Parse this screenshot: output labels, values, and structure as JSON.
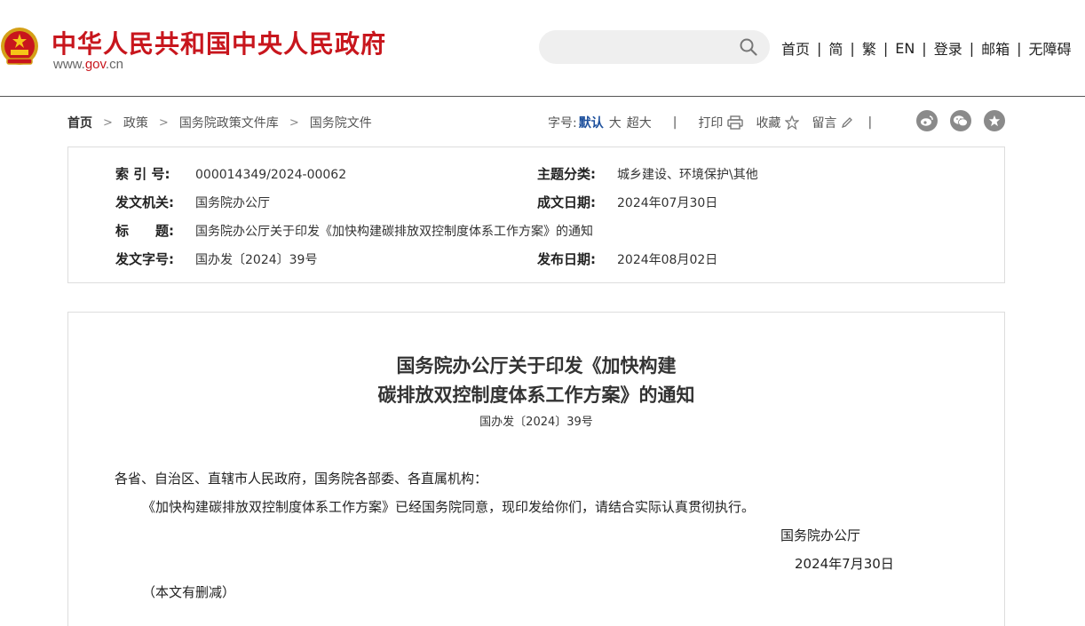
{
  "header": {
    "site_title": "中华人民共和国中央人民政府",
    "site_url_prefix": "www.",
    "site_url_gov": "gov",
    "site_url_suffix": ".cn",
    "search": {
      "placeholder": ""
    },
    "topnav": [
      "首页",
      "简",
      "繁",
      "EN",
      "登录",
      "邮箱",
      "无障碍"
    ]
  },
  "breadcrumb": [
    "首页",
    "政策",
    "国务院政策文件库",
    "国务院文件"
  ],
  "tools": {
    "font_size_label": "字号:",
    "font_default": "默认",
    "font_large": "大",
    "font_xlarge": "超大",
    "print": "打印",
    "favorite": "收藏",
    "comment": "留言",
    "share_icons": [
      "weibo-icon",
      "wechat-icon",
      "star-share-icon"
    ]
  },
  "info": {
    "index_no_label": "索 引 号:",
    "index_no": "000014349/2024-00062",
    "topic_label": "主题分类:",
    "topic": "城乡建设、环境保护\\其他",
    "issuer_label": "发文机关:",
    "issuer": "国务院办公厅",
    "written_date_label": "成文日期:",
    "written_date": "2024年07月30日",
    "title_label": "标　　题:",
    "title": "国务院办公厅关于印发《加快构建碳排放双控制度体系工作方案》的通知",
    "doc_no_label": "发文字号:",
    "doc_no": "国办发〔2024〕39号",
    "publish_date_label": "发布日期:",
    "publish_date": "2024年08月02日"
  },
  "article": {
    "title_line1": "国务院办公厅关于印发《加快构建",
    "title_line2": "碳排放双控制度体系工作方案》的通知",
    "doc_no": "国办发〔2024〕39号",
    "addressee": "各省、自治区、直辖市人民政府，国务院各部委、各直属机构：",
    "body": "《加快构建碳排放双控制度体系工作方案》已经国务院同意，现印发给你们，请结合实际认真贯彻执行。",
    "signer": "国务院办公厅",
    "date": "2024年7月30日",
    "note": "（本文有删减）"
  },
  "colors": {
    "brand_red": "#c8161d",
    "accent_blue": "#1c4f9c",
    "share_gray": "#8a8a8a"
  }
}
